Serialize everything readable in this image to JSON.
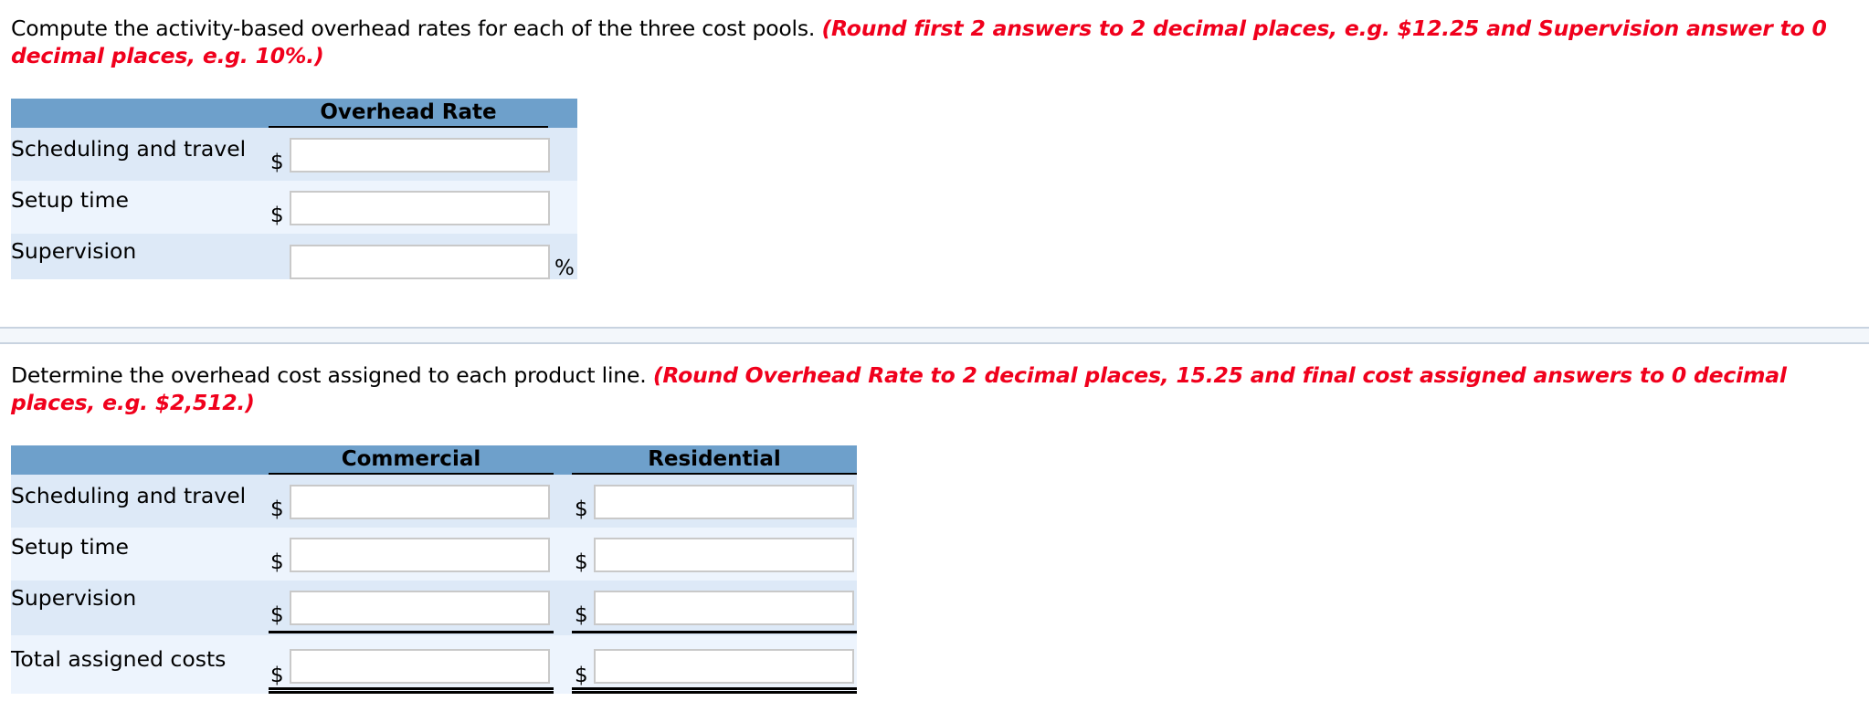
{
  "part1": {
    "instruction": "Compute the activity-based overhead rates for each of the three cost pools.",
    "note": "(Round first 2 answers to 2 decimal places, e.g. $12.25 and Supervision answer to 0 decimal places, e.g. 10%.)",
    "table": {
      "column_header": "Overhead Rate",
      "rows": [
        {
          "label": "Scheduling and travel",
          "prefix": "$",
          "suffix": "",
          "value": ""
        },
        {
          "label": "Setup time",
          "prefix": "$",
          "suffix": "",
          "value": ""
        },
        {
          "label": "Supervision",
          "prefix": "",
          "suffix": "%",
          "value": ""
        }
      ]
    }
  },
  "part2": {
    "instruction": "Determine the overhead cost assigned to each product line.",
    "note": "(Round Overhead Rate to 2 decimal places, 15.25 and final cost assigned answers to 0 decimal places, e.g. $2,512.)",
    "table": {
      "column_headers": [
        "Commercial",
        "Residential"
      ],
      "rows": [
        {
          "label": "Scheduling and travel",
          "prefix": "$",
          "values": [
            "",
            ""
          ]
        },
        {
          "label": "Setup time",
          "prefix": "$",
          "values": [
            "",
            ""
          ]
        },
        {
          "label": "Supervision",
          "prefix": "$",
          "values": [
            "",
            ""
          ]
        },
        {
          "label": "Total assigned costs",
          "prefix": "$",
          "values": [
            "",
            ""
          ]
        }
      ]
    }
  },
  "colors": {
    "header_band": "#6ea0cb",
    "row_dark": "#dde9f7",
    "row_light": "#edf4fd",
    "note_red": "#f0001c"
  }
}
